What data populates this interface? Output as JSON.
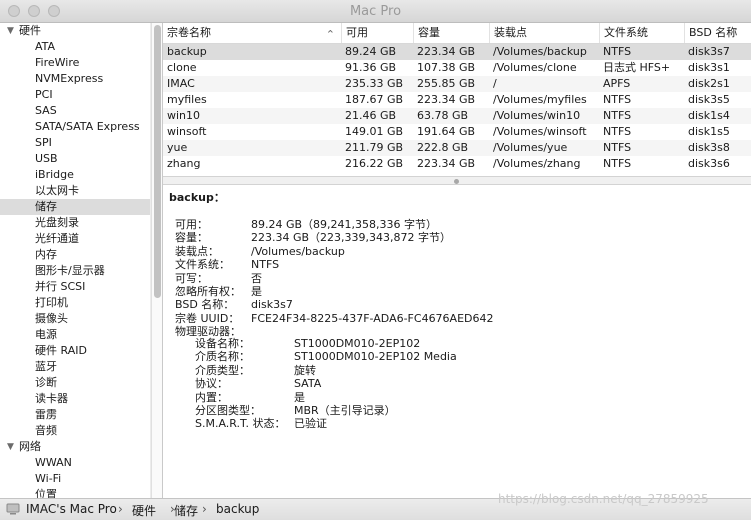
{
  "window": {
    "title": "Mac Pro"
  },
  "sidebar": {
    "groups": [
      {
        "label": "硬件",
        "children": [
          "ATA",
          "FireWire",
          "NVMExpress",
          "PCI",
          "SAS",
          "SATA/SATA Express",
          "SPI",
          "USB",
          "iBridge",
          "以太网卡",
          "储存",
          "光盘刻录",
          "光纤通道",
          "内存",
          "图形卡/显示器",
          "并行 SCSI",
          "打印机",
          "摄像头",
          "电源",
          "硬件 RAID",
          "蓝牙",
          "诊断",
          "读卡器",
          "雷雳",
          "音频"
        ]
      },
      {
        "label": "网络",
        "children": [
          "WWAN",
          "Wi-Fi",
          "位置"
        ]
      }
    ],
    "selected": "储存"
  },
  "table": {
    "columns": [
      "宗卷名称",
      "可用",
      "容量",
      "装载点",
      "文件系统",
      "BSD 名称"
    ],
    "sort_indicator": "⌃",
    "rows": [
      [
        "backup",
        "89.24 GB",
        "223.34 GB",
        "/Volumes/backup",
        "NTFS",
        "disk3s7"
      ],
      [
        "clone",
        "91.36 GB",
        "107.38 GB",
        "/Volumes/clone",
        "日志式 HFS+",
        "disk3s1"
      ],
      [
        "IMAC",
        "235.33 GB",
        "255.85 GB",
        "/",
        "APFS",
        "disk2s1"
      ],
      [
        "myfiles",
        "187.67 GB",
        "223.34 GB",
        "/Volumes/myfiles",
        "NTFS",
        "disk3s5"
      ],
      [
        "win10",
        "21.46 GB",
        "63.78 GB",
        "/Volumes/win10",
        "NTFS",
        "disk1s4"
      ],
      [
        "winsoft",
        "149.01 GB",
        "191.64 GB",
        "/Volumes/winsoft",
        "NTFS",
        "disk1s5"
      ],
      [
        "yue",
        "211.79 GB",
        "222.8 GB",
        "/Volumes/yue",
        "NTFS",
        "disk3s8"
      ],
      [
        "zhang",
        "216.22 GB",
        "223.34 GB",
        "/Volumes/zhang",
        "NTFS",
        "disk3s6"
      ]
    ],
    "selected_row": 0
  },
  "detail": {
    "title": "backup：",
    "fields": [
      {
        "k": "可用：",
        "v": "89.24 GB（89,241,358,336 字节）"
      },
      {
        "k": "容量：",
        "v": "223.34 GB（223,339,343,872 字节）"
      },
      {
        "k": "装载点：",
        "v": "/Volumes/backup"
      },
      {
        "k": "文件系统：",
        "v": "NTFS"
      },
      {
        "k": "可写：",
        "v": "否"
      },
      {
        "k": "忽略所有权：",
        "v": "是"
      },
      {
        "k": "BSD 名称：",
        "v": "disk3s7"
      },
      {
        "k": "宗卷 UUID：",
        "v": "FCE24F34-8225-437F-ADA6-FC4676AED642"
      },
      {
        "k": "物理驱动器：",
        "v": ""
      }
    ],
    "drive": [
      {
        "k": "设备名称：",
        "v": "ST1000DM010-2EP102"
      },
      {
        "k": "介质名称：",
        "v": "ST1000DM010-2EP102 Media"
      },
      {
        "k": "介质类型：",
        "v": "旋转"
      },
      {
        "k": "协议：",
        "v": "SATA"
      },
      {
        "k": "内置：",
        "v": "是"
      },
      {
        "k": "分区图类型：",
        "v": "MBR（主引导记录）"
      },
      {
        "k": "S.M.A.R.T. 状态：",
        "v": "已验证"
      }
    ]
  },
  "statusbar": {
    "computer": "IMAC's Mac Pro",
    "path": [
      "硬件",
      "储存",
      "backup"
    ],
    "separator": "›"
  },
  "watermark": "https://blog.csdn.net/qq_27859925",
  "colors": {
    "selection": "#dcdcdc",
    "header_bg": "#d6d6d6"
  }
}
